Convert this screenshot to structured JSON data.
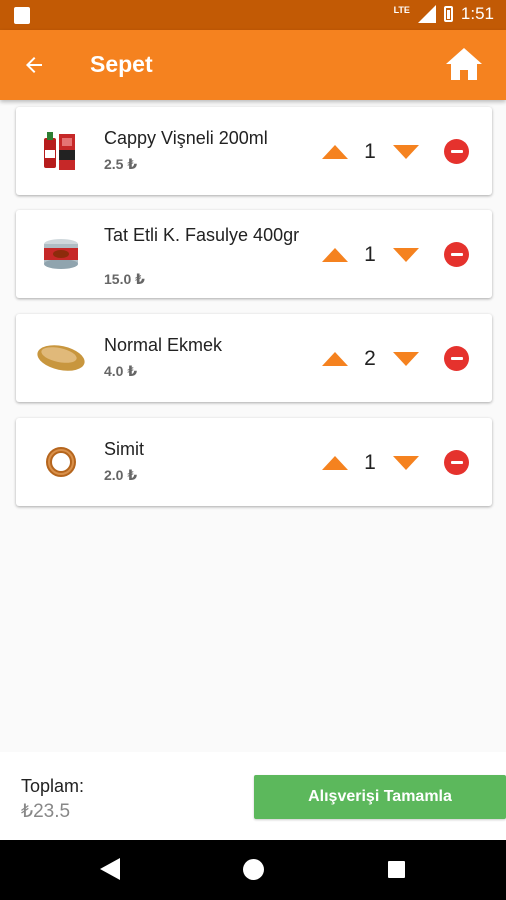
{
  "status_bar": {
    "network": "LTE",
    "time": "1:51"
  },
  "header": {
    "title": "Sepet"
  },
  "cart": {
    "items": [
      {
        "name": "Cappy Vişneli 200ml",
        "price": "2.5 ₺",
        "quantity": "1",
        "image": "juice-box-image"
      },
      {
        "name": "Tat Etli K. Fasulye 400gr",
        "price": "15.0 ₺",
        "quantity": "1",
        "image": "canned-food-image"
      },
      {
        "name": "Normal Ekmek",
        "price": "4.0 ₺",
        "quantity": "2",
        "image": "bread-image"
      },
      {
        "name": "Simit",
        "price": "2.0 ₺",
        "quantity": "1",
        "image": "simit-image"
      }
    ]
  },
  "footer": {
    "total_label": "Toplam:",
    "total_value": "₺23.5",
    "checkout_label": "Alışverişi Tamamla"
  },
  "colors": {
    "primary": "#f5821f",
    "status_bar": "#c25a05",
    "accent_arrow": "#f5821f",
    "remove": "#e5322d",
    "checkout": "#5cb85c"
  }
}
